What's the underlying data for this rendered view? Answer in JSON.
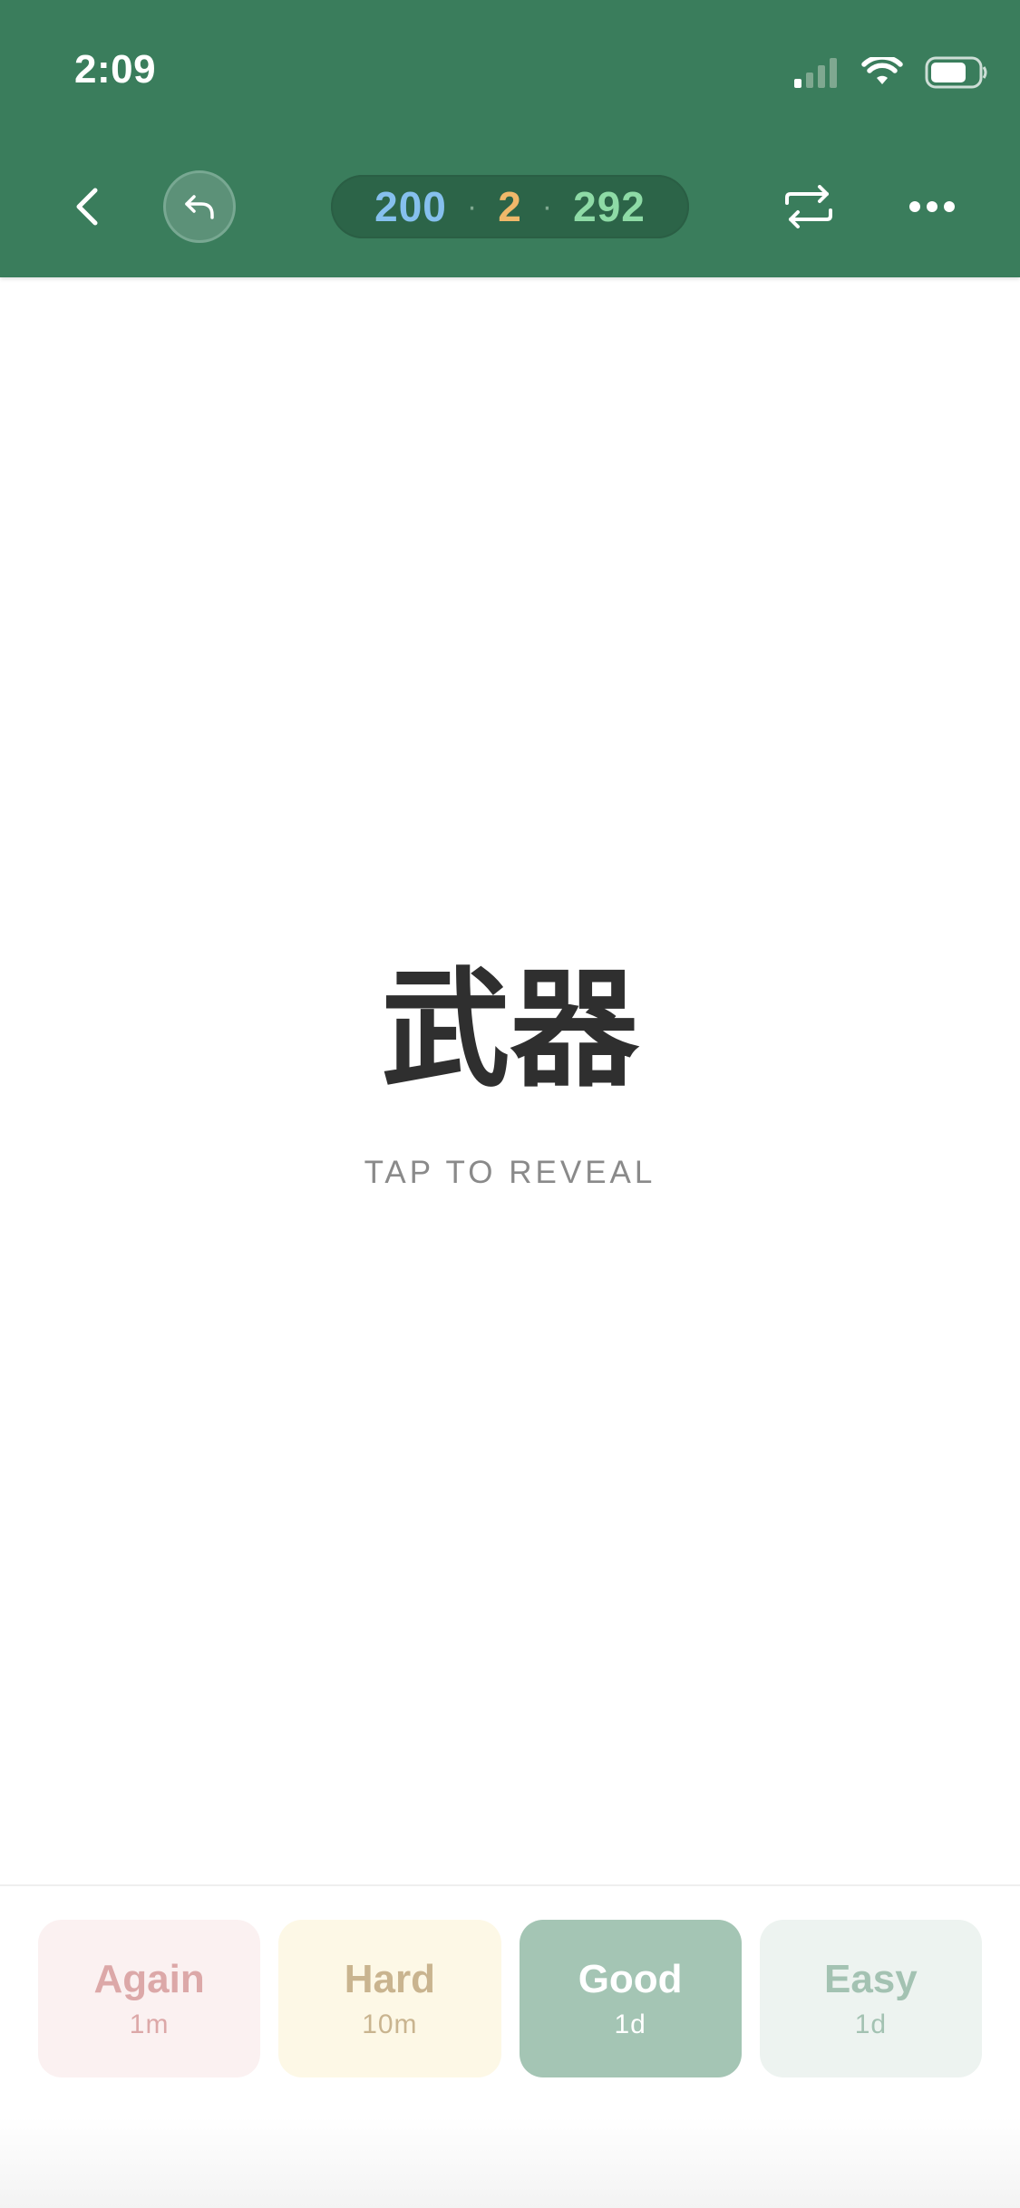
{
  "status_bar": {
    "time": "2:09",
    "signal_icon": "cellular-signal-icon",
    "wifi_icon": "wifi-icon",
    "battery_icon": "battery-icon"
  },
  "header": {
    "background_color": "#3a7d5c",
    "back_icon": "chevron-left-icon",
    "undo_icon": "undo-arrow-icon",
    "counts": {
      "new": "200",
      "learning": "2",
      "review": "292",
      "separator": "·",
      "new_color": "#86c0ee",
      "learning_color": "#f0b86a",
      "review_color": "#8edba6"
    },
    "switch_icon": "repeat-arrows-icon",
    "more_icon": "more-dots-icon"
  },
  "card": {
    "front": "武器",
    "hint": "TAP TO REVEAL"
  },
  "answer_buttons": [
    {
      "label": "Again",
      "interval": "1m",
      "color": "#dca8a8"
    },
    {
      "label": "Hard",
      "interval": "10m",
      "color": "#c9b48f"
    },
    {
      "label": "Good",
      "interval": "1d",
      "color": "#a4c5b4"
    },
    {
      "label": "Easy",
      "interval": "1d",
      "color": "#a3c2b2"
    }
  ]
}
